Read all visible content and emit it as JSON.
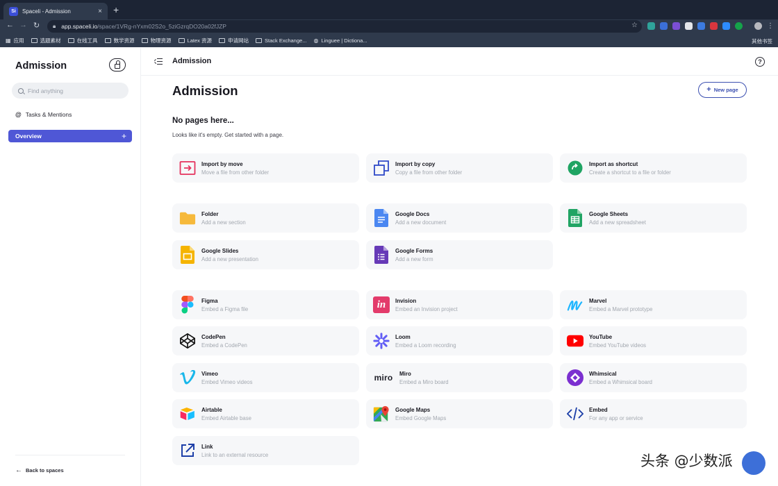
{
  "browser": {
    "tab_title": "Spaceli - Admission",
    "favicon_text": "Si",
    "tab_close": "×",
    "new_tab": "+",
    "url_host": "app.spaceli.io",
    "url_path": "/space/1VRg-nYxm02S2o_5ziGzrqDO20a02fJZP",
    "bookmarks": [
      "应用",
      "选题素材",
      "在线工具",
      "数学资源",
      "物理资源",
      "Latex 资源",
      "申请网站",
      "Stack Exchange...",
      "Linguee | Dictiona..."
    ],
    "other_bookmarks": "其他书签"
  },
  "sidebar": {
    "title": "Admission",
    "search_placeholder": "Find anything",
    "tasks_label": "Tasks & Mentions",
    "overview_label": "Overview",
    "back_label": "Back to spaces"
  },
  "topbar": {
    "crumb": "Admission",
    "help": "?"
  },
  "main": {
    "title": "Admission",
    "new_page": "New page",
    "empty_title": "No pages here...",
    "empty_sub": "Looks like it's empty. Get started with a page."
  },
  "cards": [
    {
      "title": "Import by move",
      "sub": "Move a file from other folder",
      "icon": "import-move-icon"
    },
    {
      "title": "Import by copy",
      "sub": "Copy a file from other folder",
      "icon": "import-copy-icon"
    },
    {
      "title": "Import as shortcut",
      "sub": "Create a shortcut to a file or folder",
      "icon": "shortcut-icon"
    },
    {
      "title": "Folder",
      "sub": "Add a new section",
      "icon": "folder-icon"
    },
    {
      "title": "Google Docs",
      "sub": "Add a new document",
      "icon": "google-docs-icon"
    },
    {
      "title": "Google Sheets",
      "sub": "Add a new spreadsheet",
      "icon": "google-sheets-icon"
    },
    {
      "title": "Google Slides",
      "sub": "Add a new presentation",
      "icon": "google-slides-icon"
    },
    {
      "title": "Google Forms",
      "sub": "Add a new form",
      "icon": "google-forms-icon"
    },
    {
      "title": "Figma",
      "sub": "Embed a Figma file",
      "icon": "figma-icon"
    },
    {
      "title": "Invision",
      "sub": "Embed an Invision project",
      "icon": "invision-icon"
    },
    {
      "title": "Marvel",
      "sub": "Embed a Marvel prototype",
      "icon": "marvel-icon"
    },
    {
      "title": "CodePen",
      "sub": "Embed a CodePen",
      "icon": "codepen-icon"
    },
    {
      "title": "Loom",
      "sub": "Embed a Loom recording",
      "icon": "loom-icon"
    },
    {
      "title": "YouTube",
      "sub": "Embed YouTube videos",
      "icon": "youtube-icon"
    },
    {
      "title": "Vimeo",
      "sub": "Embed Vimeo videos",
      "icon": "vimeo-icon"
    },
    {
      "title": "Miro",
      "sub": "Embed a Miro board",
      "icon": "miro-icon"
    },
    {
      "title": "Whimsical",
      "sub": "Embed a Whimsical board",
      "icon": "whimsical-icon"
    },
    {
      "title": "Airtable",
      "sub": "Embed Airtable base",
      "icon": "airtable-icon"
    },
    {
      "title": "Google Maps",
      "sub": "Embed Google Maps",
      "icon": "google-maps-icon"
    },
    {
      "title": "Embed",
      "sub": "For any app or service",
      "icon": "embed-icon"
    },
    {
      "title": "Link",
      "sub": "Link to an external resource",
      "icon": "link-icon"
    }
  ],
  "miro_logo_text": "miro",
  "invision_logo_text": "in",
  "watermark": "头条 @少数派",
  "colors": {
    "accent": "#4f57d6",
    "new_page_border": "#3b4fb0",
    "card_bg": "#f6f7f9"
  }
}
